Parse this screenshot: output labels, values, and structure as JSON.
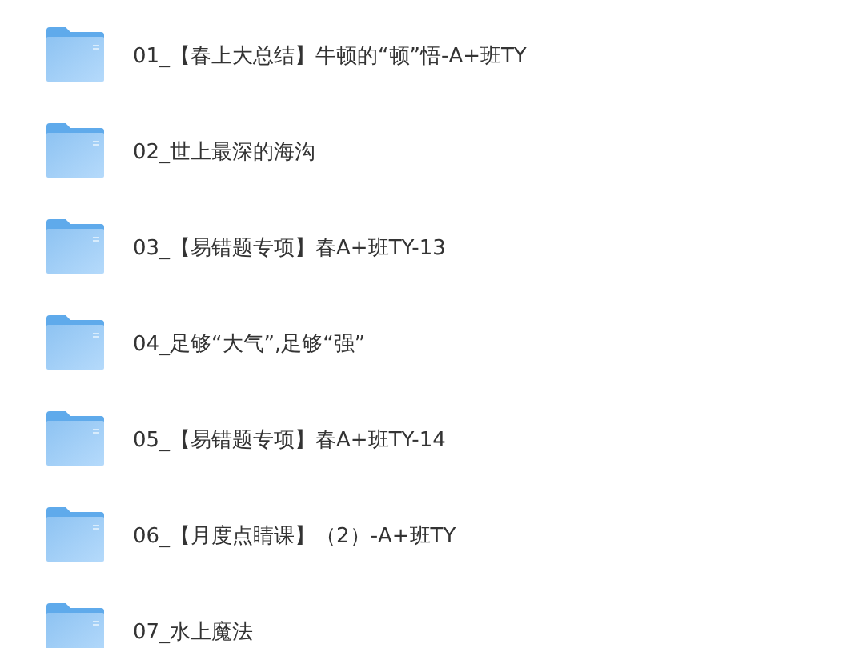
{
  "folders": [
    {
      "name": "01_【春上大总结】牛顿的“顿”悟-A+班TY"
    },
    {
      "name": "02_世上最深的海沟"
    },
    {
      "name": "03_【易错题专项】春A+班TY-13"
    },
    {
      "name": "04_足够“大气”,足够“强”"
    },
    {
      "name": "05_【易错题专项】春A+班TY-14"
    },
    {
      "name": "06_【月度点睛课】（2）-A+班TY"
    },
    {
      "name": "07_水上魔法"
    }
  ]
}
